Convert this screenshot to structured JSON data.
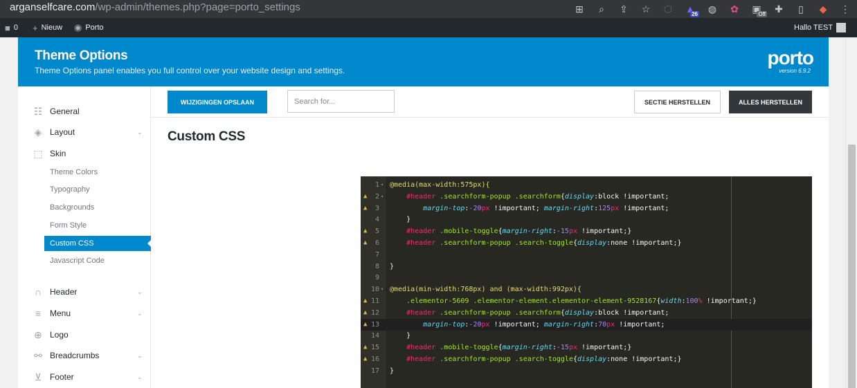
{
  "browser": {
    "url_host": "arganselfcare.com",
    "url_path": "/wp-admin/themes.php?page=porto_settings",
    "ext_badge": "26",
    "off_badge": "Off"
  },
  "admin_bar": {
    "comments_count": "0",
    "new_label": "Nieuw",
    "site_label": "Porto",
    "greeting": "Hallo TEST"
  },
  "banner": {
    "title": "Theme Options",
    "subtitle": "Theme Options panel enables you full control over your website design and settings.",
    "logo": "porto",
    "version": "version 6.9.2"
  },
  "sidebar": {
    "items": [
      {
        "label": "General"
      },
      {
        "label": "Layout"
      },
      {
        "label": "Skin"
      },
      {
        "label": "Header"
      },
      {
        "label": "Menu"
      },
      {
        "label": "Logo"
      },
      {
        "label": "Breadcrumbs"
      },
      {
        "label": "Footer"
      }
    ],
    "skin_sub": [
      {
        "label": "Theme Colors"
      },
      {
        "label": "Typography"
      },
      {
        "label": "Backgrounds"
      },
      {
        "label": "Form Style"
      },
      {
        "label": "Custom CSS"
      },
      {
        "label": "Javascript Code"
      }
    ]
  },
  "toolbar": {
    "save_label": "WIJZIGINGEN OPSLAAN",
    "search_placeholder": "Search for...",
    "reset_section_label": "SECTIE HERSTELLEN",
    "reset_all_label": "ALLES HERSTELLEN"
  },
  "section_title": "Custom CSS",
  "editor": {
    "line_numbers": [
      "1",
      "2",
      "3",
      "4",
      "5",
      "6",
      "7",
      "8",
      "9",
      "10",
      "11",
      "12",
      "13",
      "14",
      "15",
      "16",
      "17"
    ],
    "warning_lines": [
      2,
      3,
      5,
      6,
      11,
      12,
      13,
      15,
      16
    ],
    "fold_lines": [
      1,
      2,
      10
    ],
    "current_line": 13,
    "colors": {
      "background": "#272822",
      "tag": "#f92672",
      "class": "#a6e22e",
      "property": "#66d9ef",
      "number": "#ae81ff",
      "at_rule": "#e6db74"
    }
  }
}
